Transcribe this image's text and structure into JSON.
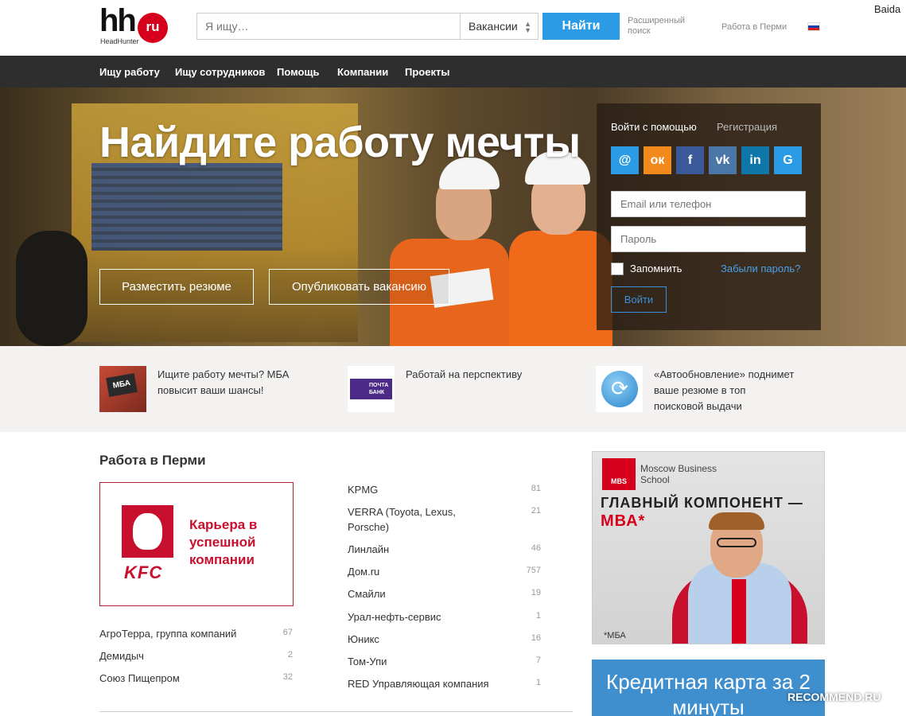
{
  "header": {
    "logo_text": "hh",
    "logo_badge": "ru",
    "logo_sub": "HeadHunter",
    "search_placeholder": "Я ищу…",
    "search_type": "Вакансии",
    "find_button": "Найти",
    "advanced_search": "Расширенный поиск",
    "city_link": "Работа в Перми",
    "username": "Baida"
  },
  "nav": {
    "items": [
      "Ищу работу",
      "Ищу сотрудников",
      "Помощь",
      "Компании",
      "Проекты"
    ]
  },
  "hero": {
    "title": "Найдите работу мечты",
    "post_resume": "Разместить резюме",
    "post_vacancy": "Опубликовать вакансию"
  },
  "login": {
    "login_with": "Войти с помощью",
    "register": "Регистрация",
    "social": [
      {
        "label": "@",
        "color": "#2b9be6",
        "icon": "mail-icon"
      },
      {
        "label": "ок",
        "color": "#f18a1b",
        "icon": "odnoklassniki-icon"
      },
      {
        "label": "f",
        "color": "#3b5998",
        "icon": "facebook-icon"
      },
      {
        "label": "vk",
        "color": "#4a76a8",
        "icon": "vk-icon"
      },
      {
        "label": "in",
        "color": "#0e76a8",
        "icon": "linkedin-icon"
      },
      {
        "label": "G",
        "color": "#2b9be6",
        "icon": "google-icon"
      }
    ],
    "email_placeholder": "Email или телефон",
    "password_placeholder": "Пароль",
    "remember": "Запомнить",
    "forgot": "Забыли пароль?",
    "submit": "Войти"
  },
  "promos": [
    {
      "text": "Ищите работу мечты? МБА повысит ваши шансы!",
      "image_label": "МБА",
      "icon": "mba-sign-icon"
    },
    {
      "text": "Работай на перспективу",
      "image_label": "ПОЧТА БАНК",
      "icon": "pochta-bank-logo"
    },
    {
      "text": "«Автообновление» поднимет ваше резюме в топ поисковой выдачи",
      "icon": "refresh-icon"
    }
  ],
  "main": {
    "section_title": "Работа в Перми",
    "kfc_logo": "KFC",
    "kfc_text": "Карьера в успешной компании",
    "left_companies": [
      {
        "name": "АгроТерра, группа компаний",
        "count": "67"
      },
      {
        "name": "Демидыч",
        "count": "2"
      },
      {
        "name": "Союз Пищепром",
        "count": "32"
      }
    ],
    "right_companies": [
      {
        "name": "KPMG",
        "count": "81"
      },
      {
        "name": "VERRA (Toyota, Lexus, Porsche)",
        "count": "21"
      },
      {
        "name": "Линлайн",
        "count": "46"
      },
      {
        "name": "Дом.ru",
        "count": "757"
      },
      {
        "name": "Смайли",
        "count": "19"
      },
      {
        "name": "Урал-нефть-сервис",
        "count": "1"
      },
      {
        "name": "Юникс",
        "count": "16"
      },
      {
        "name": "Том-Упи",
        "count": "7"
      },
      {
        "name": "RED Управляющая компания",
        "count": "1"
      }
    ]
  },
  "ads": {
    "mbs_logo": "MBS",
    "mbs_name": "Moscow Business School",
    "headline1": "ГЛАВНЫЙ КОМПОНЕНТ —",
    "headline2": "МВА*",
    "note": "*МБА",
    "credit": "Кредитная карта за 2 минуты"
  },
  "watermark": "RECOMMEND.RU"
}
